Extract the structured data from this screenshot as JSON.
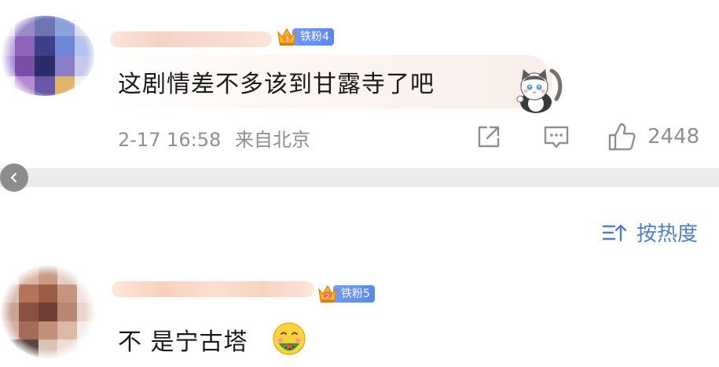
{
  "comments": [
    {
      "badge_label": "铁粉4",
      "text": "这剧情差不多该到甘露寺了吧",
      "time": "2-17 16:58",
      "location": "来自北京",
      "likes": "2448",
      "sticker_icon": "cat-sticker-icon"
    },
    {
      "badge_label": "铁粉5",
      "text": "不 是宁古塔",
      "emoji_icon": "eating-watermelon-emoji"
    }
  ],
  "sort": {
    "label": "按热度"
  },
  "colors": {
    "accent": "#4d7fd1",
    "badge": "#6f9bff",
    "meta": "#8f8f8f"
  }
}
